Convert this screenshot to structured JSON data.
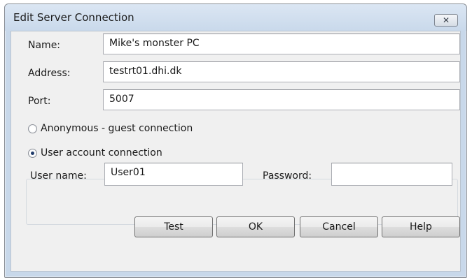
{
  "window": {
    "title": "Edit Server Connection",
    "close_glyph": "✕"
  },
  "form": {
    "name_label": "Name:",
    "name_value": "Mike's monster PC",
    "address_label": "Address:",
    "address_value": "testrt01.dhi.dk",
    "port_label": "Port:",
    "port_value": "5007"
  },
  "connection": {
    "anonymous_label": "Anonymous - guest connection",
    "anonymous_selected": false,
    "user_account_label": "User account connection",
    "user_account_selected": true,
    "username_label": "User name:",
    "username_value": "User01",
    "password_label": "Password:",
    "password_value": ""
  },
  "buttons": {
    "test": "Test",
    "ok": "OK",
    "cancel": "Cancel",
    "help": "Help"
  },
  "colors": {
    "frame": "#c8d8ea",
    "client": "#f0f0f0"
  },
  "icons": {
    "close": "close-icon",
    "radio_unchecked": "radio-unchecked-icon",
    "radio_checked": "radio-checked-icon"
  }
}
